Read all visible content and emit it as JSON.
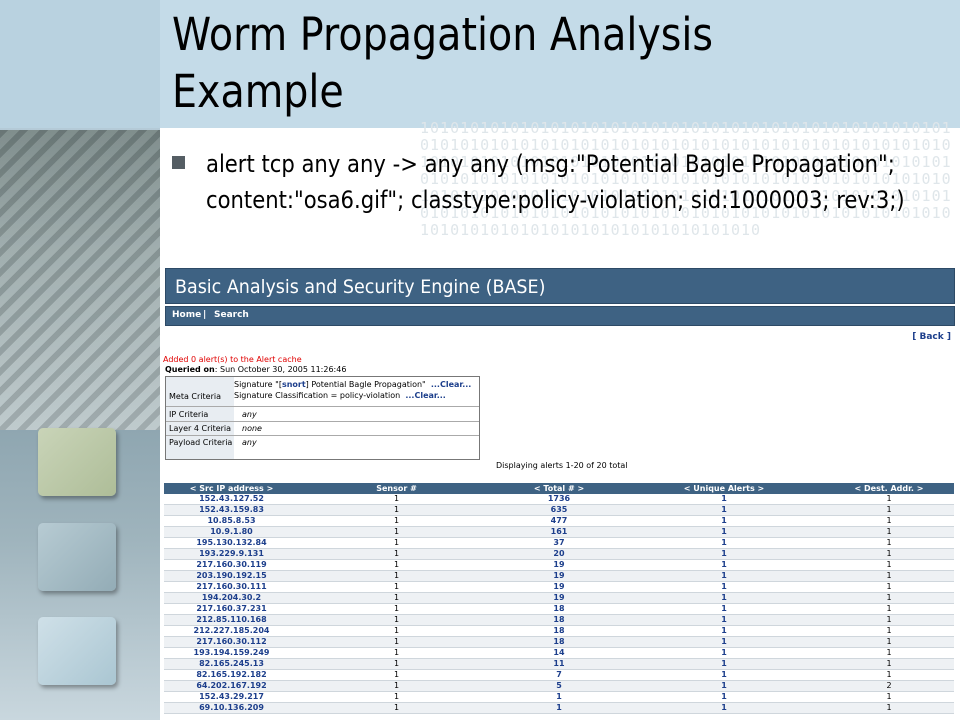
{
  "slide": {
    "title": "Worm Propagation Analysis Example",
    "bullet": "alert tcp any any -> any any (msg:\"Potential Bagle Propagation\"; content:\"osa6.gif\"; classtype:policy-violation; sid:1000003; rev:3;)",
    "binary_pattern": "1010101010101010101010101010101010101010101010101010101010101010101010101010101010101010101010101010101010101010101010101010101010101010101010101010101010101010101010101010101010101010101010101010101010101010101010101010101010101010101010101010101010101010101010101010101010101010101010101010101010101010101010101010101010101010101010101010101010101010"
  },
  "base": {
    "header_title": "Basic Analysis and Security Engine (BASE)",
    "nav": {
      "home": "Home",
      "separator": "|",
      "search": "Search"
    },
    "back_link": "[ Back ]",
    "alert_cache_message": "Added 0 alert(s) to the Alert cache",
    "queried_label": "Queried on",
    "queried_value": ": Sun October 30, 2005 11:26:46",
    "criteria": {
      "meta_label": "Meta Criteria",
      "signature_line_prefix": "Signature \"[",
      "signature_snort": "snort",
      "signature_line_suffix": "] Potential Bagle Propagation\"",
      "clear_1": "...Clear...",
      "classification_line": "Signature Classification = policy-violation",
      "clear_2": "...Clear...",
      "ip_label": "IP Criteria",
      "ip_value": "any",
      "layer4_label": "Layer 4 Criteria",
      "layer4_value": "none",
      "payload_label": "Payload Criteria",
      "payload_value": "any"
    },
    "displaying_text": "Displaying alerts 1-20 of 20 total",
    "table": {
      "headers": [
        "< Src IP address >",
        "Sensor #",
        "< Total # >",
        "< Unique Alerts >",
        "< Dest. Addr. >"
      ],
      "rows": [
        [
          "152.43.127.52",
          "1",
          "1736",
          "1",
          "1"
        ],
        [
          "152.43.159.83",
          "1",
          "635",
          "1",
          "1"
        ],
        [
          "10.85.8.53",
          "1",
          "477",
          "1",
          "1"
        ],
        [
          "10.9.1.80",
          "1",
          "161",
          "1",
          "1"
        ],
        [
          "195.130.132.84",
          "1",
          "37",
          "1",
          "1"
        ],
        [
          "193.229.9.131",
          "1",
          "20",
          "1",
          "1"
        ],
        [
          "217.160.30.119",
          "1",
          "19",
          "1",
          "1"
        ],
        [
          "203.190.192.15",
          "1",
          "19",
          "1",
          "1"
        ],
        [
          "217.160.30.111",
          "1",
          "19",
          "1",
          "1"
        ],
        [
          "194.204.30.2",
          "1",
          "19",
          "1",
          "1"
        ],
        [
          "217.160.37.231",
          "1",
          "18",
          "1",
          "1"
        ],
        [
          "212.85.110.168",
          "1",
          "18",
          "1",
          "1"
        ],
        [
          "212.227.185.204",
          "1",
          "18",
          "1",
          "1"
        ],
        [
          "217.160.30.112",
          "1",
          "18",
          "1",
          "1"
        ],
        [
          "193.194.159.249",
          "1",
          "14",
          "1",
          "1"
        ],
        [
          "82.165.245.13",
          "1",
          "11",
          "1",
          "1"
        ],
        [
          "82.165.192.182",
          "1",
          "7",
          "1",
          "1"
        ],
        [
          "64.202.167.192",
          "1",
          "5",
          "1",
          "2"
        ],
        [
          "152.43.29.217",
          "1",
          "1",
          "1",
          "1"
        ],
        [
          "69.10.136.209",
          "1",
          "1",
          "1",
          "1"
        ]
      ]
    },
    "colors": {
      "header_bg": "#3e6283",
      "link": "#1d3f8c",
      "alert_red": "#e00000"
    }
  }
}
